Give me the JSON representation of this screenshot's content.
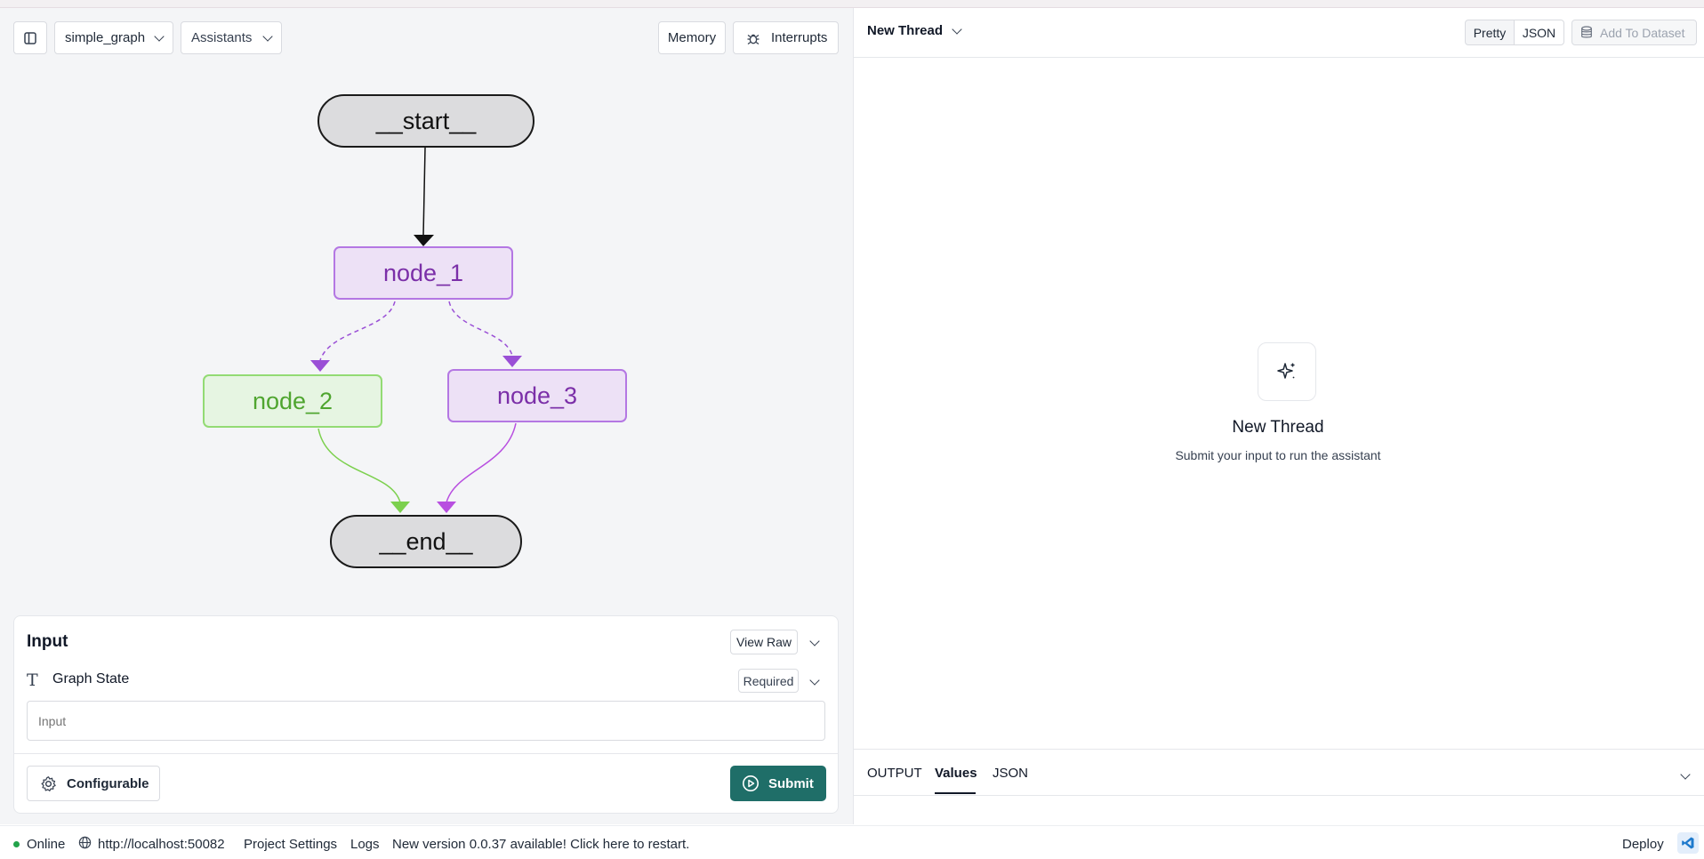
{
  "toolbar": {
    "graph_select": "simple_graph",
    "assistants_select": "Assistants",
    "memory_label": "Memory",
    "interrupts_label": "Interrupts"
  },
  "graph": {
    "start_label": "__start__",
    "node1_label": "node_1",
    "node2_label": "node_2",
    "node3_label": "node_3",
    "end_label": "__end__"
  },
  "input_panel": {
    "title": "Input",
    "view_raw_label": "View Raw",
    "field_label": "Graph State",
    "required_badge": "Required",
    "input_placeholder": "Input",
    "configurable_label": "Configurable",
    "submit_label": "Submit"
  },
  "thread": {
    "selector_label": "New Thread",
    "pretty_label": "Pretty",
    "json_label": "JSON",
    "add_dataset_label": "Add To Dataset",
    "empty_title": "New Thread",
    "empty_subtitle": "Submit your input to run the assistant"
  },
  "output_tabs": {
    "output_label": "OUTPUT",
    "values_label": "Values",
    "json_label": "JSON"
  },
  "status": {
    "online_label": "Online",
    "server_url": "http://localhost:50082",
    "project_settings_label": "Project Settings",
    "logs_label": "Logs",
    "update_notice": "New version 0.0.37 available! Click here to restart.",
    "deploy_label": "Deploy"
  },
  "colors": {
    "purple_node": "#7b2fa8",
    "green_node": "#4fa52f",
    "submit_bg": "#1f6e68",
    "online_dot": "#22a34a"
  },
  "icons": [
    "sidebar-toggle-icon",
    "chevron-down-icon",
    "bug-icon",
    "text-type-icon",
    "gear-icon",
    "play-circle-icon",
    "database-icon",
    "sparkle-icon",
    "globe-icon",
    "vscode-icon"
  ]
}
